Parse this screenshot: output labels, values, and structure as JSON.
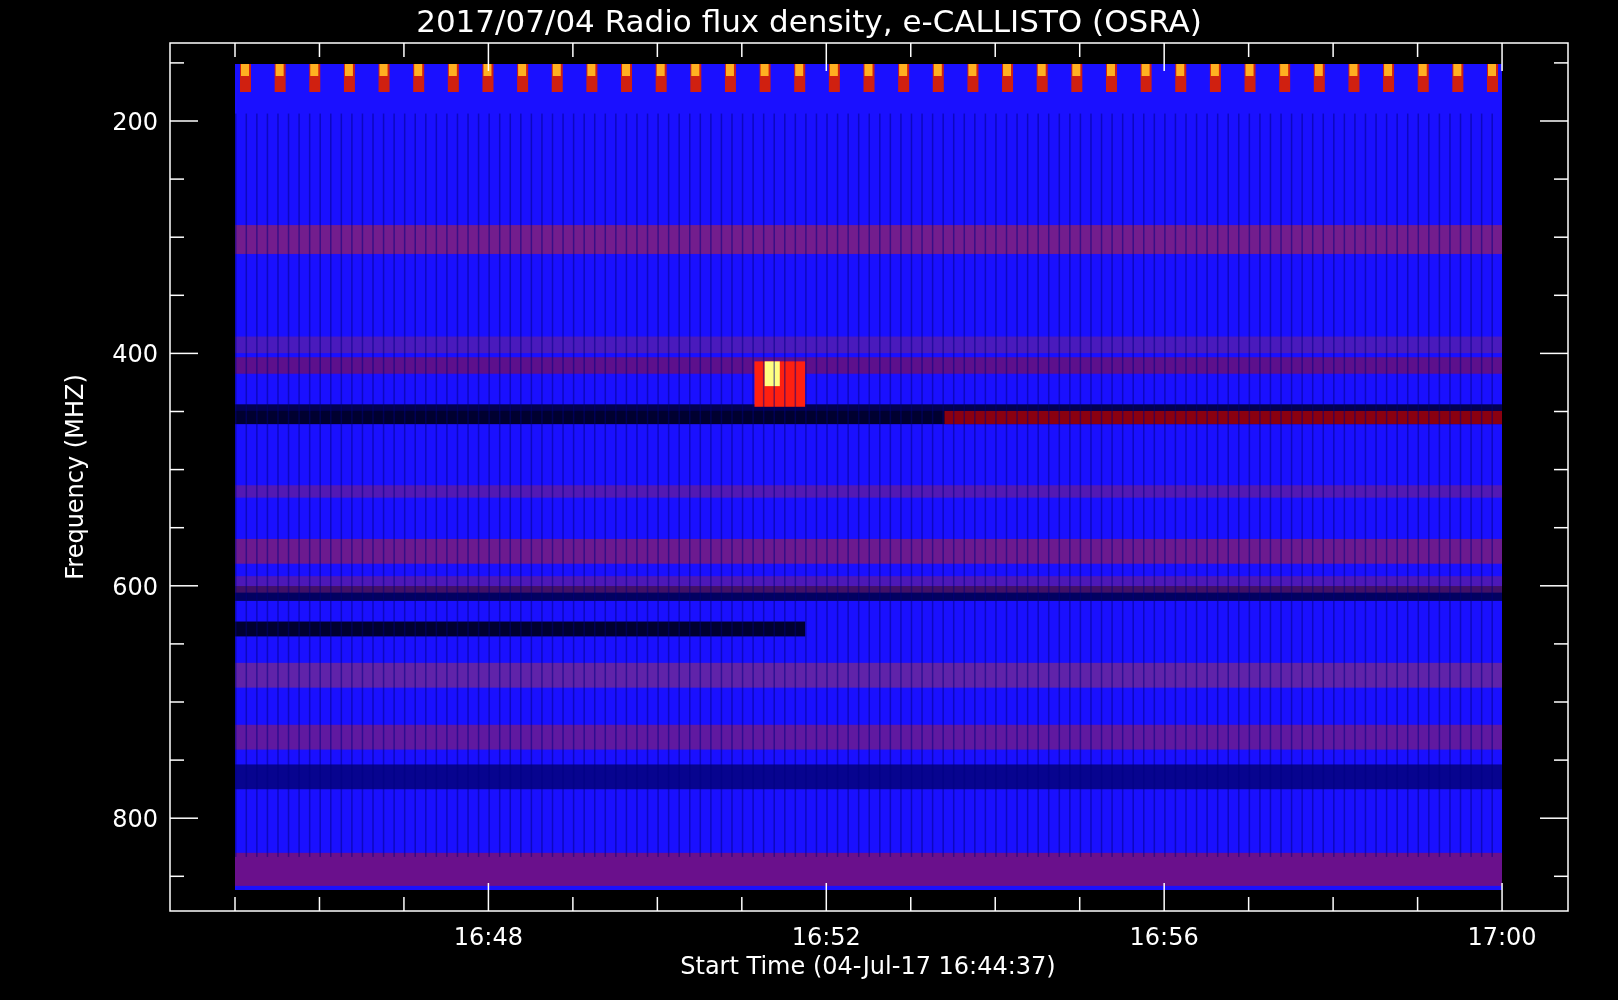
{
  "title": "2017/07/04  Radio flux density, e-CALLISTO (OSRA)",
  "y_axis": {
    "label": "Frequency (MHZ)",
    "ticks": [
      "200",
      "400",
      "600",
      "800"
    ]
  },
  "x_axis": {
    "label": "Start Time (04-Jul-17 16:44:37)",
    "ticks": [
      "16:48",
      "16:52",
      "16:56",
      "17:00"
    ]
  }
}
